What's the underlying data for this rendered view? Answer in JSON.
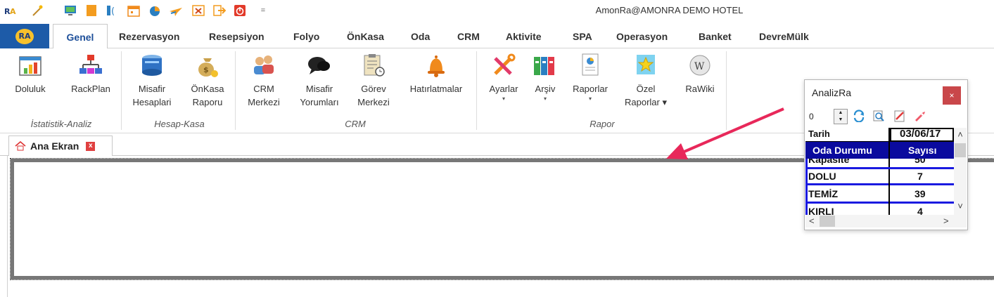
{
  "window": {
    "title": "AmonRa@AMONRA DEMO HOTEL"
  },
  "quick_access": {
    "icons": [
      "ra-logo-icon",
      "magic-wand-icon",
      "monitor-icon",
      "notepad-icon",
      "bracket-icon",
      "calendar-icon",
      "pie-chart-icon",
      "plane-icon",
      "x-window-icon",
      "exit-icon",
      "power-icon"
    ],
    "customize_caret": "="
  },
  "app_button": {
    "logo": "RA"
  },
  "tabs": [
    "Genel",
    "Rezervasyon",
    "Resepsiyon",
    "Folyo",
    "ÖnKasa",
    "Oda",
    "CRM",
    "Aktivite",
    "SPA",
    "Operasyon",
    "Banket",
    "DevreMülk"
  ],
  "ribbon": {
    "buttons": [
      {
        "line1": "Doluluk",
        "line2": "",
        "icon": "occupancy-chart-icon"
      },
      {
        "line1": "RackPlan",
        "line2": "",
        "icon": "org-chart-icon"
      },
      {
        "line1": "Misafir",
        "line2": "Hesaplari",
        "icon": "guest-accounts-icon"
      },
      {
        "line1": "ÖnKasa",
        "line2": "Raporu",
        "icon": "money-bag-icon"
      },
      {
        "line1": "CRM",
        "line2": "Merkezi",
        "icon": "crm-people-icon"
      },
      {
        "line1": "Misafir",
        "line2": "Yorumları",
        "icon": "speech-bubbles-icon"
      },
      {
        "line1": "Görev",
        "line2": "Merkezi",
        "icon": "clipboard-icon"
      },
      {
        "line1": "Hatırlatmalar",
        "line2": "",
        "icon": "bell-icon"
      },
      {
        "line1": "Ayarlar",
        "line2": "▾",
        "icon": "tools-icon"
      },
      {
        "line1": "Arşiv",
        "line2": "▾",
        "icon": "binders-icon"
      },
      {
        "line1": "Raporlar",
        "line2": "▾",
        "icon": "report-icon"
      },
      {
        "line1": "Özel",
        "line2": "Raporlar ▾",
        "icon": "star-report-icon"
      },
      {
        "line1": "RaWiki",
        "line2": "",
        "icon": "wiki-globe-icon"
      }
    ],
    "groups": [
      "İstatistik-Analiz",
      "Hesap-Kasa",
      "CRM",
      "Rapor"
    ]
  },
  "doc_tabs": [
    {
      "label": "Ana Ekran",
      "close": "x"
    }
  ],
  "analiz_window": {
    "title": "AnalizRa",
    "close": "×",
    "spin_value": "0",
    "tarih_label": "Tarih",
    "tarih_value": "03/06/17",
    "columns": [
      "Oda Durumu",
      "Sayısı"
    ],
    "rows": [
      {
        "name": "Kapasite",
        "value": "50"
      },
      {
        "name": "DOLU",
        "value": "7"
      },
      {
        "name": "TEMİZ",
        "value": "39"
      },
      {
        "name": "KIRLI",
        "value": "4"
      }
    ],
    "scroll_up": "˄",
    "scroll_down": "˅",
    "scroll_left": "<",
    "scroll_right": ">"
  },
  "colors": {
    "tab_active": "#1d4f9a",
    "app_button": "#1d5ba8",
    "grid_header": "#0a0a9e",
    "arrow": "#e8285a",
    "close_button": "#c9474a"
  }
}
